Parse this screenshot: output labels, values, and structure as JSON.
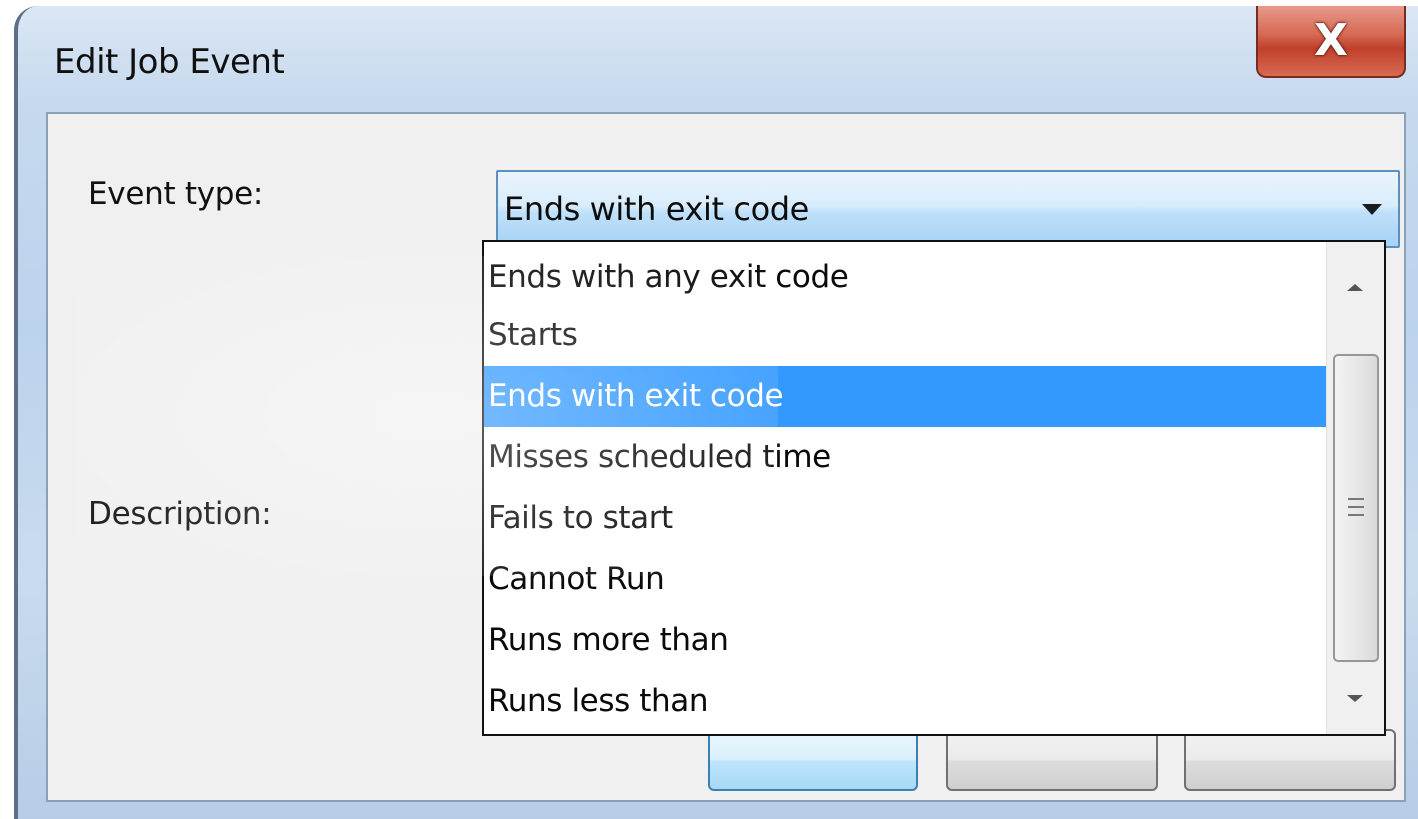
{
  "window": {
    "title": "Edit Job Event",
    "close_label": "X"
  },
  "form": {
    "event_type_label": "Event type:",
    "event_type_value": "Ends with exit code",
    "description_label": "Description:"
  },
  "dropdown": {
    "options": [
      "Ends with any exit code",
      "Starts",
      "Ends with exit code",
      "Misses scheduled time",
      "Fails to start",
      "Cannot Run",
      "Runs more than",
      "Runs less than"
    ],
    "selected_index": 2
  },
  "colors": {
    "selection": "#3399ff",
    "close_button": "#c0402b"
  }
}
